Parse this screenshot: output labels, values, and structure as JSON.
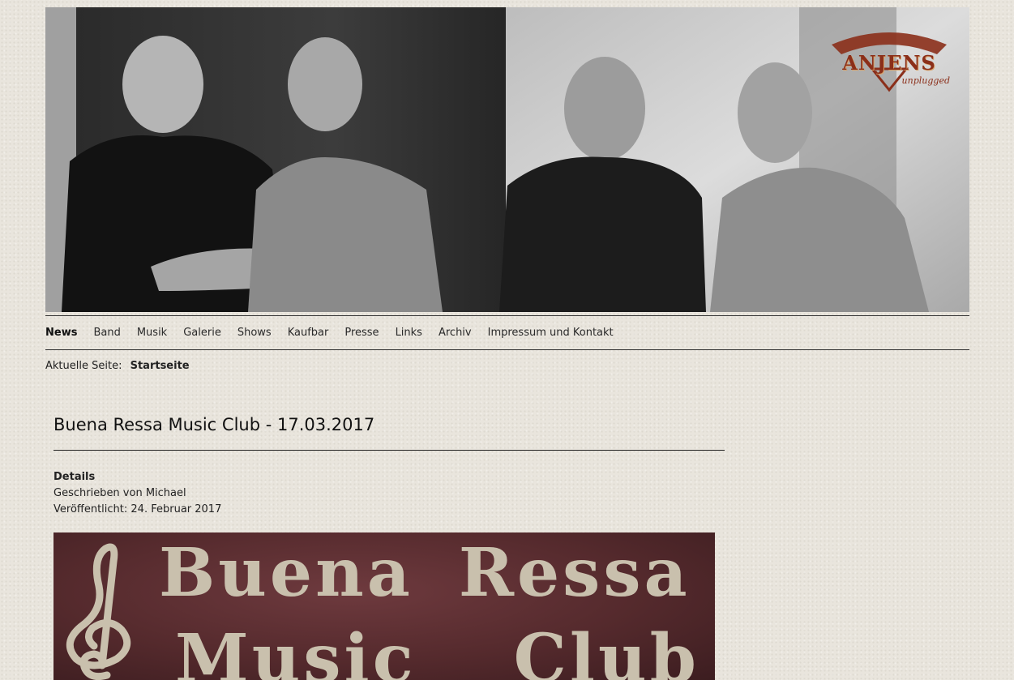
{
  "banner": {
    "alt": "Band photo",
    "logo": {
      "name": "ANJENS",
      "sub": "unplugged"
    }
  },
  "nav": {
    "items": [
      {
        "label": "News",
        "active": true
      },
      {
        "label": "Band"
      },
      {
        "label": "Musik"
      },
      {
        "label": "Galerie"
      },
      {
        "label": "Shows"
      },
      {
        "label": "Kaufbar"
      },
      {
        "label": "Presse"
      },
      {
        "label": "Links"
      },
      {
        "label": "Archiv"
      },
      {
        "label": "Impressum und Kontakt"
      }
    ]
  },
  "breadcrumb": {
    "prefix": "Aktuelle Seite:",
    "current": "Startseite"
  },
  "article": {
    "title": "Buena Ressa Music Club - 17.03.2017",
    "details_heading": "Details",
    "author": "Geschrieben von Michael",
    "published": "Veröffentlicht: 24. Februar 2017",
    "poster": {
      "word1": "Buena",
      "word2": "Ressa",
      "word3": "Music",
      "word4": "Club"
    }
  },
  "colors": {
    "background": "#e9e5dd",
    "poster": "#552a2d",
    "poster_text": "#c9c0ad",
    "logo": "#8b2f1a"
  },
  "icons": [
    "treble-clef-icon",
    "logo-emblem-icon"
  ]
}
